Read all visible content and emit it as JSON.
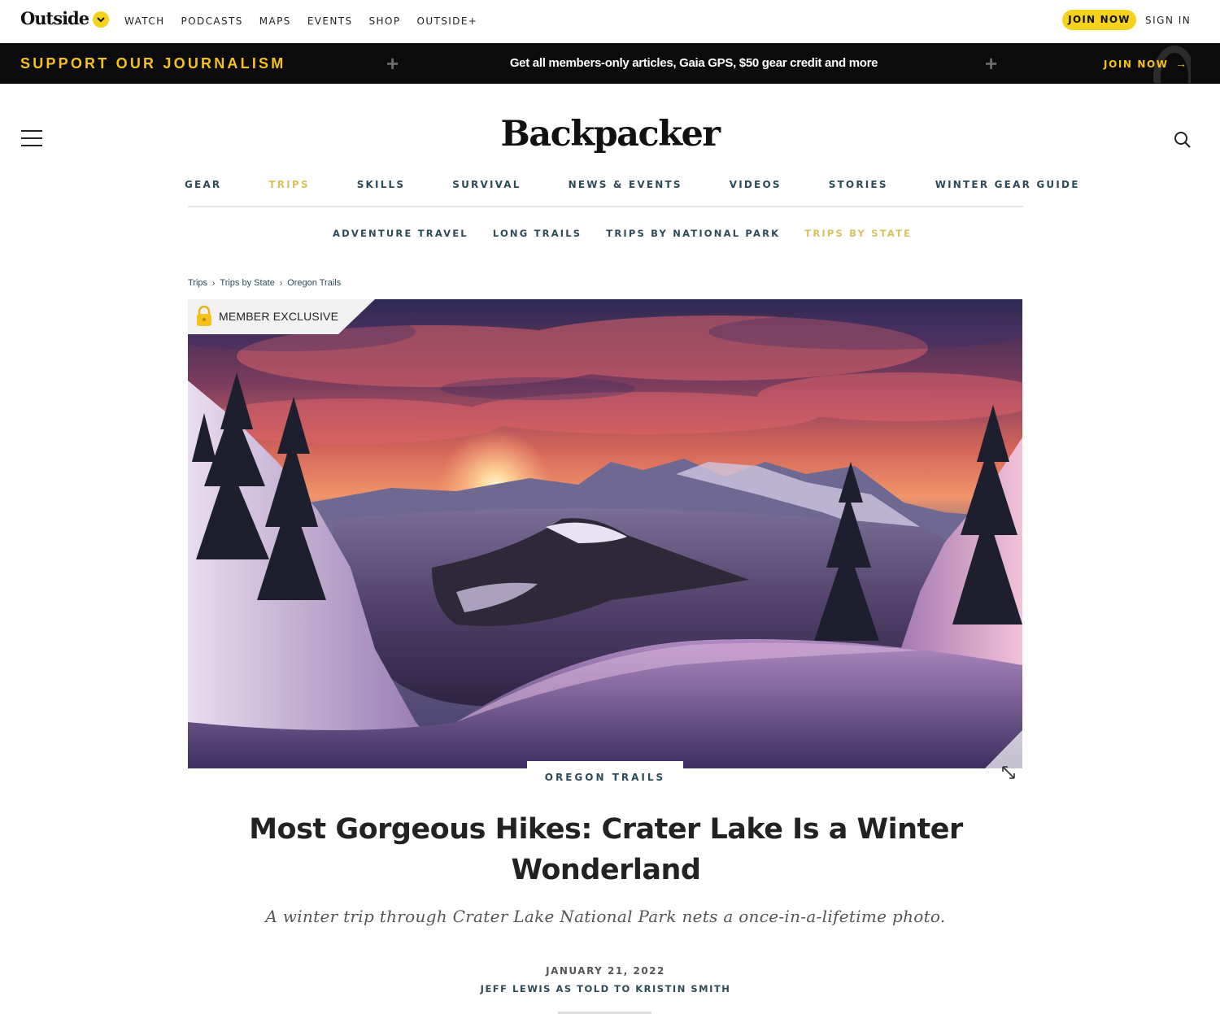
{
  "outside_bar": {
    "logo": "Outside",
    "nav": [
      "WATCH",
      "PODCASTS",
      "MAPS",
      "EVENTS",
      "SHOP",
      "OUTSIDE+"
    ],
    "join_label": "JOIN NOW",
    "signin_label": "SIGN IN",
    "accent_color": "#f5d21c"
  },
  "promo": {
    "left_text": "SUPPORT OUR JOURNALISM",
    "center_text": "Get all members-only articles, Gaia GPS, $50 gear credit and more",
    "cta_label": "JOIN NOW",
    "cta_arrow": "→",
    "plus": "+",
    "accent_color": "#f5c21c"
  },
  "header": {
    "site_logo": "Backpacker",
    "menu_icon": "hamburger-menu-icon",
    "search_icon": "search-icon"
  },
  "primary_nav": [
    "GEAR",
    "TRIPS",
    "SKILLS",
    "SURVIVAL",
    "NEWS & EVENTS",
    "VIDEOS",
    "STORIES",
    "WINTER GEAR GUIDE"
  ],
  "primary_nav_active": "TRIPS",
  "secondary_nav": [
    "ADVENTURE TRAVEL",
    "LONG TRAILS",
    "TRIPS BY NATIONAL PARK",
    "TRIPS BY STATE"
  ],
  "secondary_nav_active": "TRIPS BY STATE",
  "breadcrumb": [
    "Trips",
    "Trips by State",
    "Oregon Trails"
  ],
  "breadcrumb_sep": "›",
  "hero": {
    "badge_text": "MEMBER EXCLUSIVE",
    "badge_icon": "lock-icon",
    "expand_icon": "expand-icon",
    "category": "OREGON TRAILS"
  },
  "article": {
    "headline": "Most Gorgeous Hikes: Crater Lake Is a Winter Wonderland",
    "dek": "A winter trip through Crater Lake National Park nets a once-in-a-lifetime photo.",
    "date": "JANUARY 21, 2022",
    "byline": "JEFF LEWIS AS TOLD TO KRISTIN SMITH"
  }
}
